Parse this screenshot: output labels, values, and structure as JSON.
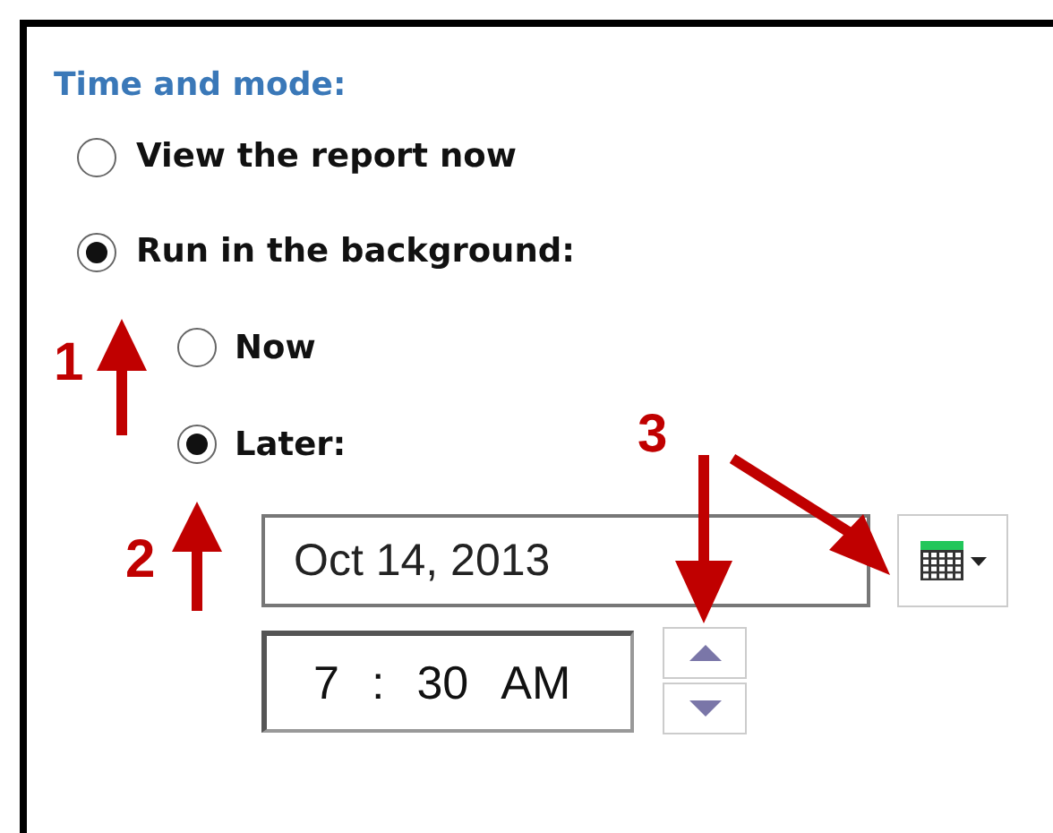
{
  "section": {
    "title": "Time and mode:"
  },
  "options": [
    {
      "label": "View the report now",
      "selected": false
    },
    {
      "label": "Run in the background:",
      "selected": true,
      "children": [
        {
          "label": "Now",
          "selected": false
        },
        {
          "label": "Later:",
          "selected": true
        }
      ]
    }
  ],
  "date_field": {
    "value": "Oct 14, 2013"
  },
  "time_field": {
    "hour": "7",
    "separator": ":",
    "minute": "30",
    "period": "AM"
  },
  "callouts": [
    {
      "label": "1"
    },
    {
      "label": "2"
    },
    {
      "label": "3"
    }
  ]
}
